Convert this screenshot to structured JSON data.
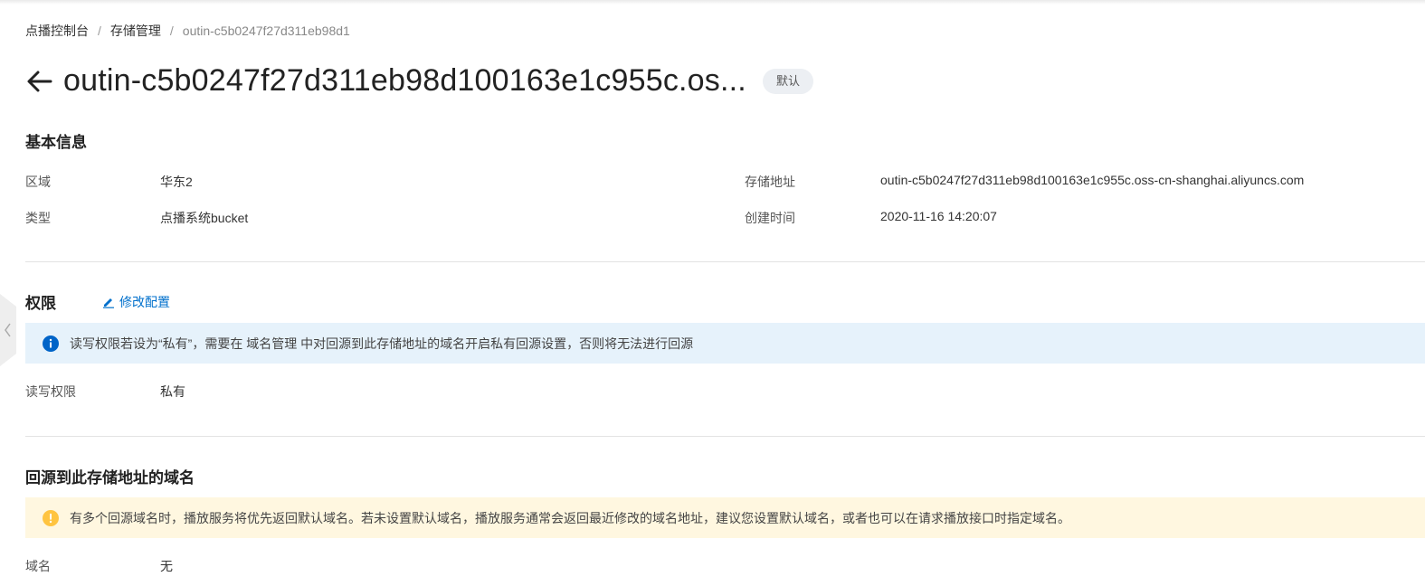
{
  "breadcrumb": {
    "items": [
      "点播控制台",
      "存储管理",
      "outin-c5b0247f27d311eb98d1"
    ],
    "separator": "/"
  },
  "header": {
    "title": "outin-c5b0247f27d311eb98d100163e1c955c.os...",
    "badge": "默认"
  },
  "basic_info": {
    "title": "基本信息",
    "region_label": "区域",
    "region_value": "华东2",
    "type_label": "类型",
    "type_value": "点播系统bucket",
    "address_label": "存储地址",
    "address_value": "outin-c5b0247f27d311eb98d100163e1c955c.oss-cn-shanghai.aliyuncs.com",
    "created_label": "创建时间",
    "created_value": "2020-11-16 14:20:07"
  },
  "permission": {
    "title": "权限",
    "edit_label": "修改配置",
    "info_text": "读写权限若设为“私有”，需要在 域名管理 中对回源到此存储地址的域名开启私有回源设置，否则将无法进行回源",
    "rw_label": "读写权限",
    "rw_value": "私有"
  },
  "domains": {
    "title": "回源到此存储地址的域名",
    "warning_text": "有多个回源域名时，播放服务将优先返回默认域名。若未设置默认域名，播放服务通常会返回最近修改的域名地址，建议您设置默认域名，或者也可以在请求播放接口时指定域名。",
    "domain_label": "域名",
    "domain_value": "无"
  },
  "colors": {
    "link": "#0070cc",
    "info_bg": "#e6f2fb",
    "info_icon": "#0064c8",
    "warn_bg": "#fff7e0",
    "warn_icon": "#ffc440"
  },
  "icons": {
    "back": "arrow-left-icon",
    "edit": "pencil-icon",
    "info": "info-circle-icon",
    "warn": "exclamation-circle-icon",
    "side": "chevron-left-icon"
  }
}
